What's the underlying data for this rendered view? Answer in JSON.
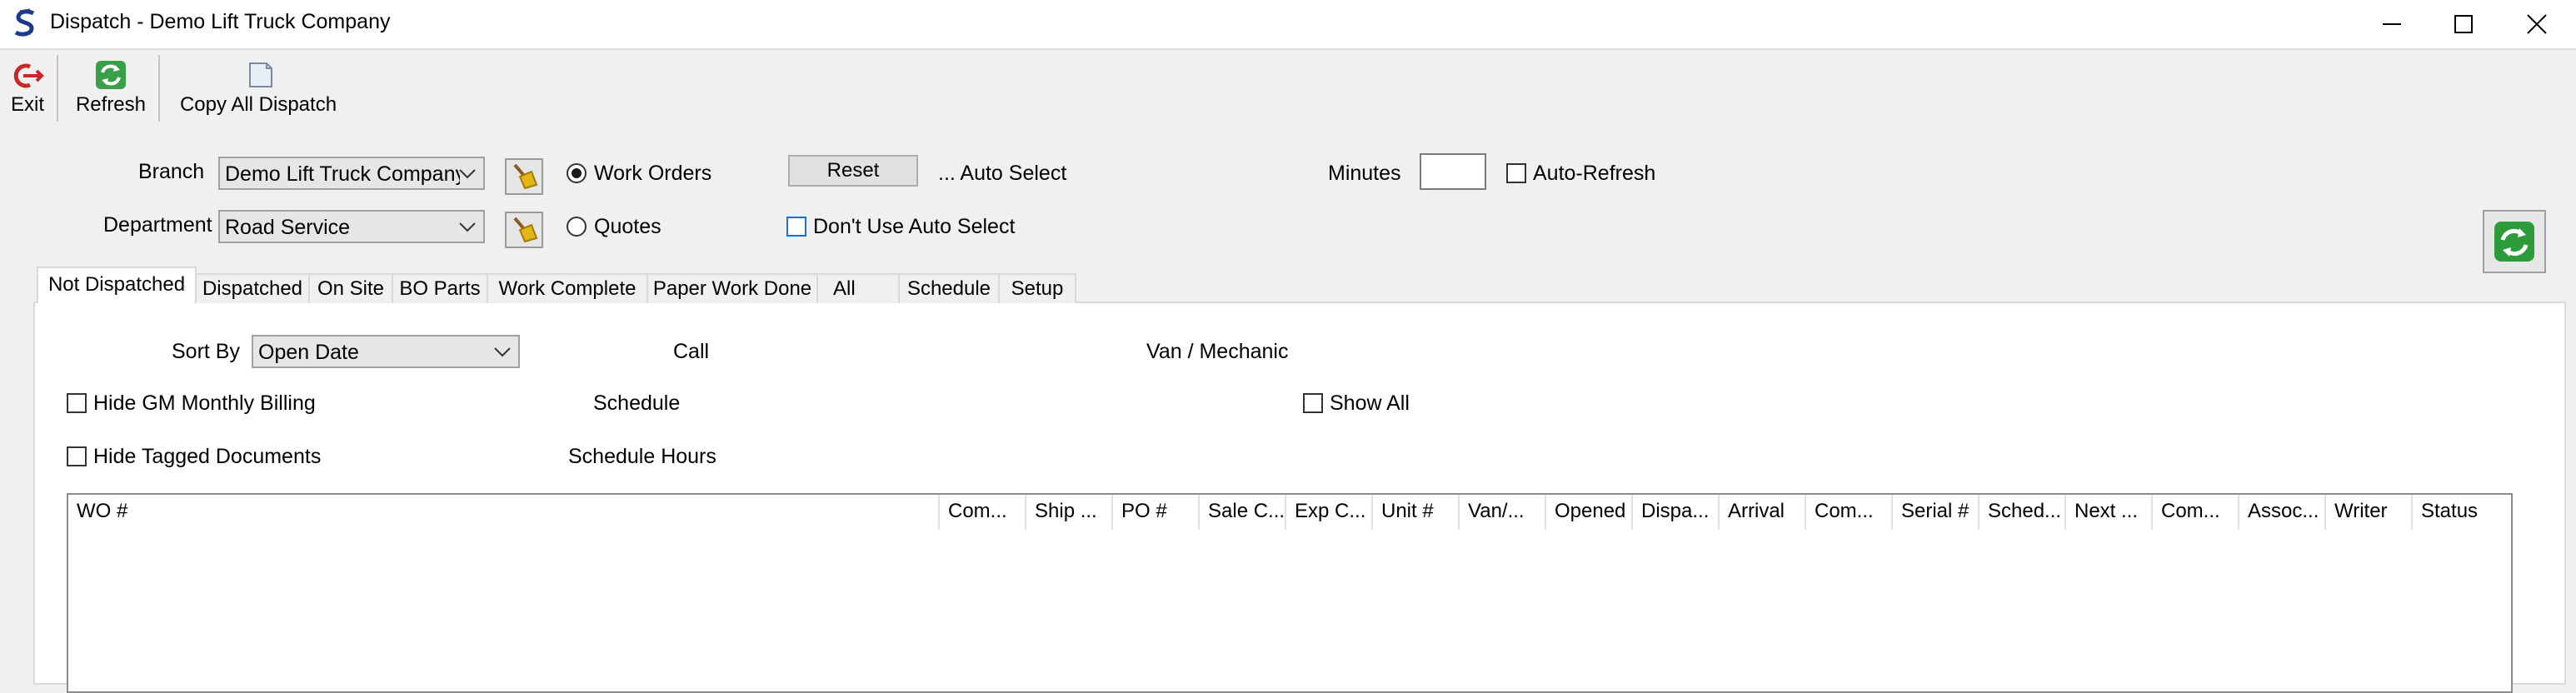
{
  "window": {
    "title": "Dispatch - Demo Lift Truck Company",
    "controls": [
      "minimize",
      "maximize",
      "close"
    ]
  },
  "toolbar": {
    "exit_label": "Exit",
    "refresh_label": "Refresh",
    "copy_label": "Copy All Dispatch"
  },
  "form": {
    "branch_label": "Branch",
    "branch_value": "Demo Lift Truck Company",
    "department_label": "Department",
    "department_value": "Road Service",
    "radio_work_orders": "Work Orders",
    "radio_quotes": "Quotes",
    "selected_radio": "Work Orders",
    "reset_label": "Reset",
    "auto_select_label": "... Auto Select",
    "dont_use_auto_select_label": "Don't Use Auto Select",
    "minutes_label": "Minutes",
    "minutes_value": "",
    "auto_refresh_label": "Auto-Refresh"
  },
  "tabs": [
    "Not Dispatched",
    "Dispatched",
    "On Site",
    "BO Parts",
    "Work Complete",
    "Paper Work Done",
    "All",
    "Schedule",
    "Setup"
  ],
  "active_tab": "Not Dispatched",
  "filters": {
    "sort_by_label": "Sort By",
    "sort_by_value": "Open Date",
    "call_label": "Call",
    "van_mechanic_label": "Van / Mechanic",
    "hide_gm_label": "Hide GM Monthly Billing",
    "schedule_label": "Schedule",
    "show_all_label": "Show All",
    "hide_tagged_label": "Hide Tagged Documents",
    "schedule_hours_label": "Schedule Hours"
  },
  "grid": {
    "columns": [
      "WO #",
      "Com...",
      "Ship ...",
      "PO #",
      "Sale C...",
      "Exp C...",
      "Unit #",
      "Van/...",
      "Opened",
      "Dispa...",
      "Arrival",
      "Com...",
      "Serial #",
      "Sched...",
      "Next ...",
      "Com...",
      "Assoc...",
      "Writer",
      "Status"
    ],
    "rows": []
  },
  "colors": {
    "accent_green": "#2e9b3a",
    "exit_red": "#c62828",
    "checkbox_blue": "#1e6fd0",
    "broom_yellow": "#e2b714"
  }
}
